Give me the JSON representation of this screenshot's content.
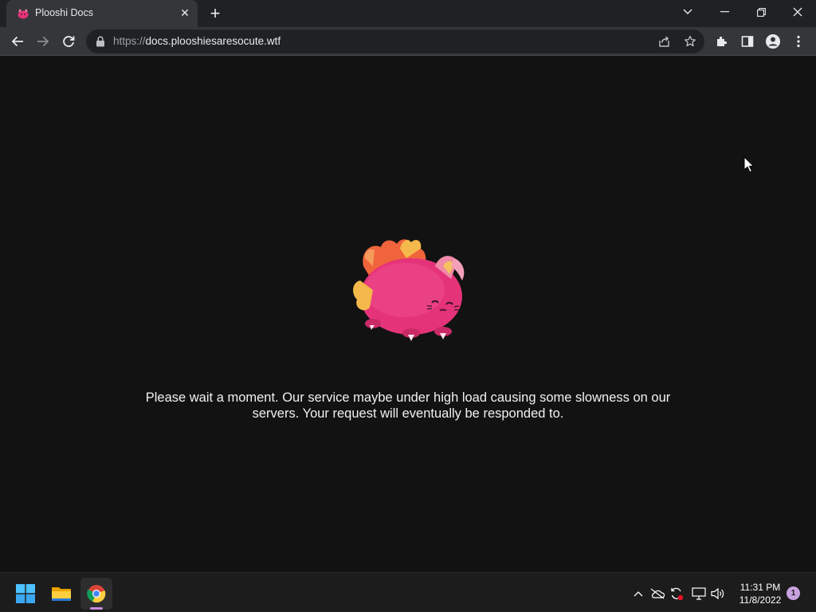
{
  "browser": {
    "tab": {
      "title": "Plooshi Docs",
      "favicon": "plooshi-favicon"
    },
    "url": {
      "scheme": "https://",
      "host": "docs.plooshiesaresocute.wtf"
    }
  },
  "page": {
    "message": "Please wait a moment. Our service maybe under high load causing some slowness on our servers. Your request will eventually be responded to."
  },
  "taskbar": {
    "time": "11:31 PM",
    "date": "11/8/2022",
    "notification_count": "1"
  },
  "colors": {
    "page_background": "#121212",
    "tab_active": "#35363a",
    "titlebar": "#202124",
    "mascot_body": "#e5337a",
    "accent_purple": "#c78ddc"
  },
  "icons": [
    "back-icon",
    "forward-icon",
    "reload-icon",
    "lock-icon",
    "share-icon",
    "star-icon",
    "extensions-icon",
    "side-panel-icon",
    "profile-icon",
    "menu-icon",
    "windows-start-icon",
    "file-explorer-icon",
    "chrome-icon",
    "chevron-up-icon",
    "onedrive-icon",
    "sync-icon",
    "network-icon",
    "volume-icon"
  ]
}
